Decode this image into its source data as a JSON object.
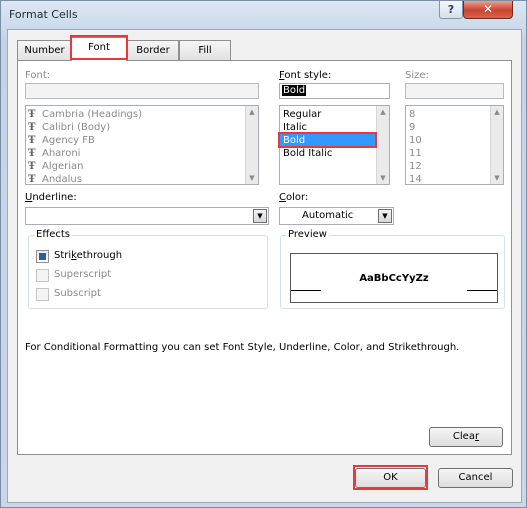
{
  "window": {
    "title": "Format Cells",
    "help_label": "?",
    "close_label": "✕"
  },
  "tabs": [
    {
      "label": "Number"
    },
    {
      "label": "Font"
    },
    {
      "label": "Border"
    },
    {
      "label": "Fill"
    }
  ],
  "font": {
    "label": "Font:",
    "value": "",
    "items": [
      "Cambria (Headings)",
      "Calibri (Body)",
      "Agency FB",
      "Aharoni",
      "Algerian",
      "Andalus"
    ],
    "item_icon": "truetype-font-icon"
  },
  "font_style": {
    "label": "Font style:",
    "value": "Bold",
    "items": [
      "Regular",
      "Italic",
      "Bold",
      "Bold Italic"
    ],
    "selected_index": 2
  },
  "size": {
    "label": "Size:",
    "value": "",
    "items": [
      "8",
      "9",
      "10",
      "11",
      "12",
      "14"
    ]
  },
  "underline": {
    "label": "Underline:",
    "value": ""
  },
  "color": {
    "label": "Color:",
    "value": "Automatic"
  },
  "effects": {
    "title": "Effects",
    "strikethrough": {
      "label": "Strikethrough",
      "checked": true
    },
    "superscript": {
      "label": "Superscript",
      "checked": false
    },
    "subscript": {
      "label": "Subscript",
      "checked": false
    }
  },
  "preview": {
    "title": "Preview",
    "sample": "AaBbCcYyZz"
  },
  "info_text": "For Conditional Formatting you can set Font Style, Underline, Color, and Strikethrough.",
  "buttons": {
    "clear": "Clear",
    "ok": "OK",
    "cancel": "Cancel"
  },
  "colors": {
    "selection": "#3399ff",
    "highlight": "#e8383d",
    "close": "#c7452e"
  }
}
